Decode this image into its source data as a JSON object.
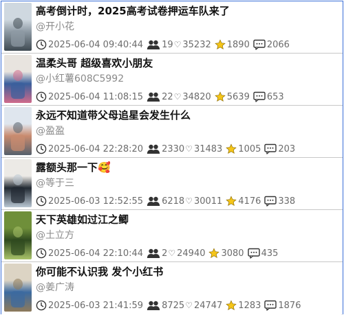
{
  "posts": [
    {
      "title": "高考倒计时，2025高考试卷押运车队来了",
      "author": "@开小花",
      "time": "2025-06-04 09:40:44",
      "followers": "19",
      "likes": "35232",
      "collects": "1890",
      "comments": "2066",
      "thumb_colors": [
        "#cfd8e0",
        "#8e9aa4",
        "#3f4a52"
      ],
      "thumb_caption": "2025高考试卷押运车队来了"
    },
    {
      "title": "温柔头哥 超级喜欢小朋友",
      "author": "@小红薯608C5992",
      "time": "2025-06-04 11:08:15",
      "followers": "22",
      "likes": "34820",
      "collects": "5639",
      "comments": "653",
      "thumb_colors": [
        "#e8e4df",
        "#3a5f9c",
        "#d06a8a"
      ],
      "thumb_caption": ""
    },
    {
      "title": "永远不知道带父母追星会发生什么",
      "author": "@盈盈",
      "time": "2025-06-04 22:28:20",
      "followers": "2330",
      "likes": "31483",
      "collects": "1005",
      "comments": "203",
      "thumb_colors": [
        "#dfe6ee",
        "#c98b6f",
        "#55606c"
      ],
      "thumb_caption": ""
    },
    {
      "title": "露额头那一下🥰",
      "author": "@等于三",
      "time": "2025-06-03 12:52:55",
      "followers": "6218",
      "likes": "30011",
      "collects": "4176",
      "comments": "338",
      "thumb_colors": [
        "#eceae6",
        "#222a33",
        "#b9c6d2"
      ],
      "thumb_caption": ""
    },
    {
      "title": "天下英雄如过江之鲫",
      "author": "@土立方",
      "time": "2025-06-04 22:10:44",
      "followers": "2",
      "likes": "24940",
      "collects": "3080",
      "comments": "435",
      "thumb_colors": [
        "#6f8f3a",
        "#2f4a1f",
        "#a9c36a"
      ],
      "thumb_caption": ""
    },
    {
      "title": "你可能不认识我 发个小红书",
      "author": "@姜广涛",
      "time": "2025-06-03 21:41:59",
      "followers": "8725",
      "likes": "24747",
      "collects": "1283",
      "comments": "1876",
      "thumb_colors": [
        "#dcd4c4",
        "#3c6aa0",
        "#8e7a5a"
      ],
      "thumb_caption": ""
    }
  ],
  "icons": {
    "time": "clock-icon",
    "followers": "users-icon",
    "likes": "heart-icon",
    "collects": "star-icon",
    "comments": "comment-icon"
  },
  "colors": {
    "border": "#3a6fd8",
    "divider": "#c7c7c7",
    "star": "#f5c518",
    "meta_text": "#6b6b6b",
    "author_text": "#8a8a8a"
  }
}
